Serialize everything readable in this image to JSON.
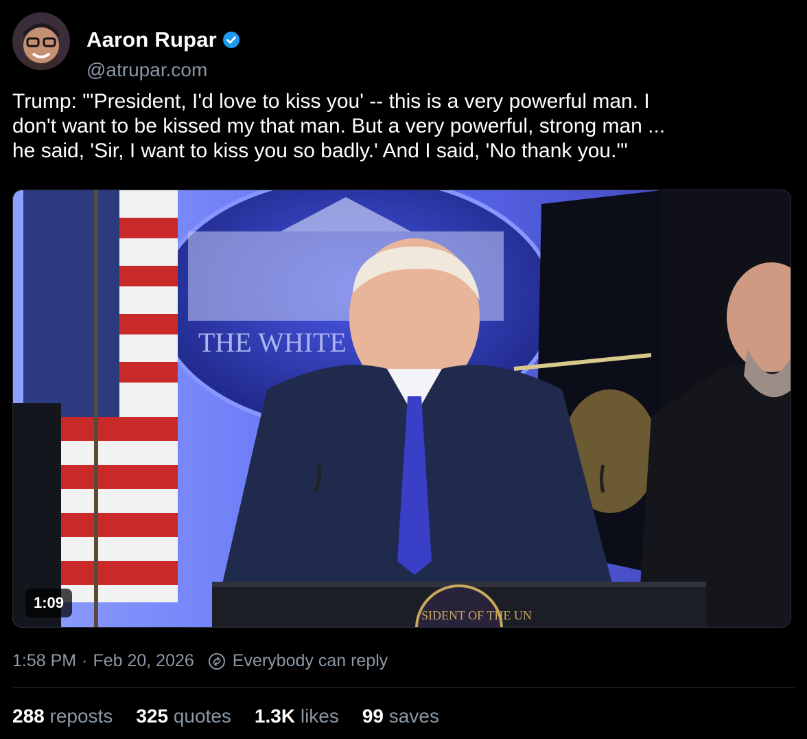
{
  "author": {
    "name": "Aaron Rupar",
    "handle": "@atrupar.com",
    "verified": true,
    "verified_color": "#1d9bf0"
  },
  "post": {
    "text_lines": [
      "Trump: \"'President, I'd love to kiss you' -- this is a very powerful man. I",
      "don't want to be kissed my that man. But a very powerful, strong man ...",
      "he said, 'Sir, I want to kiss you so badly.' And I said, 'No thank you.'\""
    ]
  },
  "video": {
    "duration": "1:09",
    "background_text": "THE WHITE",
    "podium_text": "SIDENT OF THE UN"
  },
  "meta": {
    "time": "1:58 PM",
    "separator": "·",
    "date": "Feb 20, 2026",
    "reply_setting": "Everybody can reply"
  },
  "stats": [
    {
      "count": "288",
      "label": "reposts"
    },
    {
      "count": "325",
      "label": "quotes"
    },
    {
      "count": "1.3K",
      "label": "likes"
    },
    {
      "count": "99",
      "label": "saves"
    }
  ],
  "colors": {
    "background": "#000000",
    "secondary_text": "#8b98a5",
    "accent": "#1d9bf0"
  }
}
